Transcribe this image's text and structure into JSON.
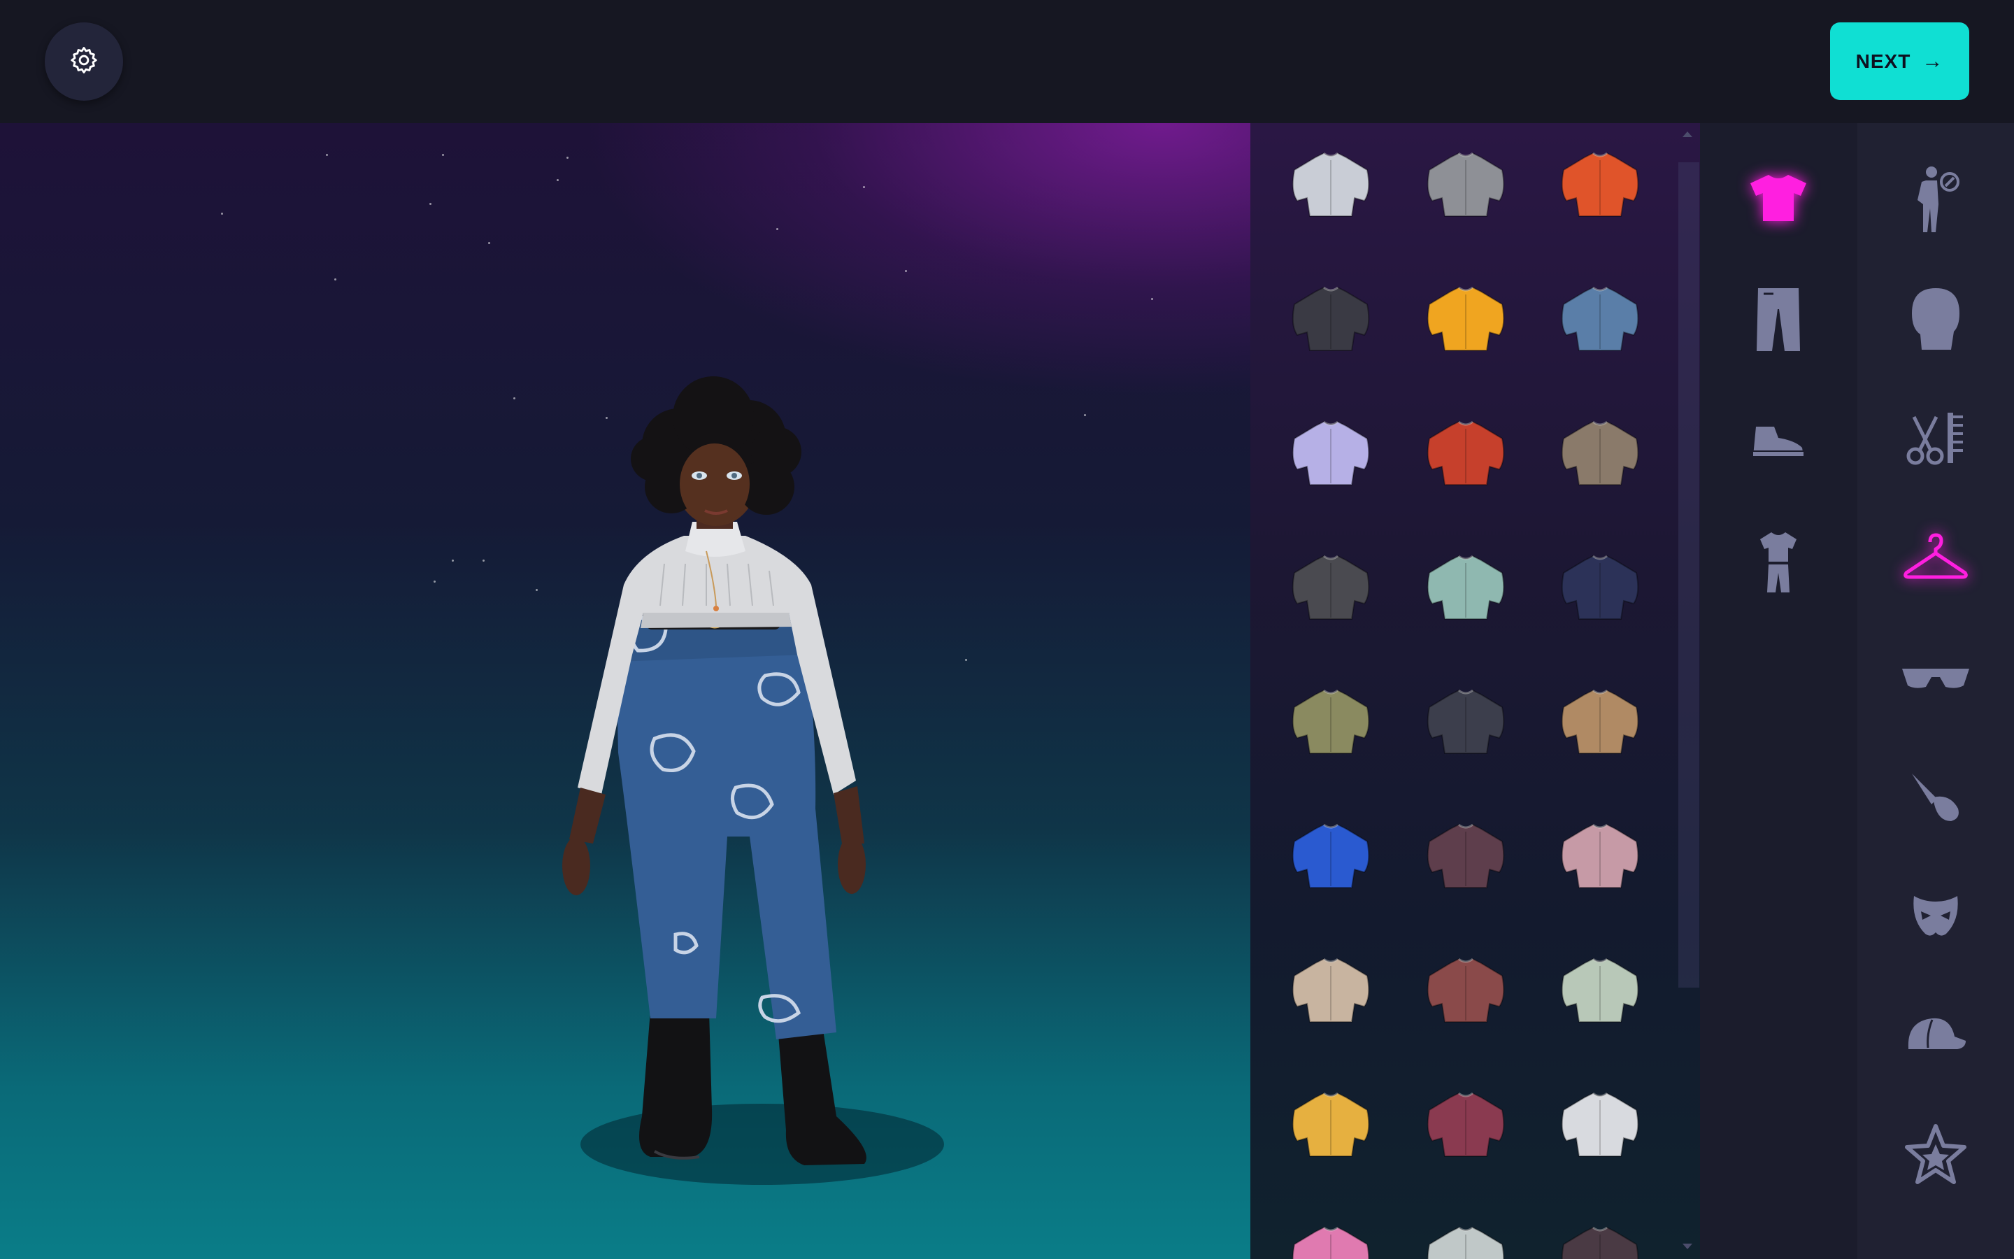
{
  "header": {
    "settings_icon": "gear-icon",
    "next_label": "NEXT",
    "next_arrow": "→"
  },
  "colors": {
    "accent_active": "#ff1fe0",
    "next_button": "#10dfd3",
    "icon_inactive": "#7a7d9e"
  },
  "avatar": {
    "description_icon": "avatar-figure"
  },
  "items": [
    {
      "name": "white-tshirt",
      "color": "#c9cdd6"
    },
    {
      "name": "grey-denim-jacket",
      "color": "#8e9096"
    },
    {
      "name": "orange-puffer-jacket",
      "color": "#e0542a"
    },
    {
      "name": "graffiti-puffer-jacket",
      "color": "#3a3a44"
    },
    {
      "name": "yellow-hoodie",
      "color": "#f0a520"
    },
    {
      "name": "denim-jacket",
      "color": "#5a7ea8"
    },
    {
      "name": "holographic-puffer-jacket",
      "color": "#b6b0e6"
    },
    {
      "name": "red-black-bomber",
      "color": "#c6402c"
    },
    {
      "name": "beige-coat-scarf",
      "color": "#8a7a6a"
    },
    {
      "name": "black-parka",
      "color": "#4a4a50"
    },
    {
      "name": "mint-hoodie",
      "color": "#8fb8b0"
    },
    {
      "name": "navy-hoodie",
      "color": "#2c3258"
    },
    {
      "name": "camo-jacket",
      "color": "#8a8a60"
    },
    {
      "name": "charcoal-sweater",
      "color": "#3c3e4c"
    },
    {
      "name": "tan-sweater",
      "color": "#b08a64"
    },
    {
      "name": "blue-print-sweater",
      "color": "#2a5ad0"
    },
    {
      "name": "plum-hoodie",
      "color": "#5e3e4c"
    },
    {
      "name": "pastel-colorblock-hoodie",
      "color": "#c69aa6"
    },
    {
      "name": "cream-hoodie",
      "color": "#c8b4a0"
    },
    {
      "name": "maroon-grey-bomber",
      "color": "#8a4a4a"
    },
    {
      "name": "sage-cardigan",
      "color": "#b8c8b8"
    },
    {
      "name": "yellow-stripe-jacket",
      "color": "#e6b040"
    },
    {
      "name": "maroon-tshirt",
      "color": "#8a3a50"
    },
    {
      "name": "white-hoodie",
      "color": "#d8dadf"
    },
    {
      "name": "floral-jacket",
      "color": "#e07ab0"
    },
    {
      "name": "silver-puffer",
      "color": "#c0c8c8"
    },
    {
      "name": "dark-plaid-jacket",
      "color": "#4a3a44"
    }
  ],
  "subcategories": [
    {
      "name": "tops",
      "icon": "tshirt-icon",
      "active": true
    },
    {
      "name": "bottoms",
      "icon": "pants-icon",
      "active": false
    },
    {
      "name": "shoes",
      "icon": "sneaker-icon",
      "active": false
    },
    {
      "name": "outfits",
      "icon": "outfit-icon",
      "active": false
    }
  ],
  "categories": [
    {
      "name": "body",
      "icon": "body-icon",
      "active": false
    },
    {
      "name": "head",
      "icon": "head-icon",
      "active": false
    },
    {
      "name": "hair",
      "icon": "scissors-comb-icon",
      "active": false
    },
    {
      "name": "clothing",
      "icon": "hanger-icon",
      "active": true
    },
    {
      "name": "glasses",
      "icon": "sunglasses-icon",
      "active": false
    },
    {
      "name": "makeup",
      "icon": "makeup-brush-icon",
      "active": false
    },
    {
      "name": "masks",
      "icon": "mask-icon",
      "active": false
    },
    {
      "name": "headwear",
      "icon": "cap-icon",
      "active": false
    },
    {
      "name": "favorites",
      "icon": "star-icon",
      "active": false
    }
  ]
}
